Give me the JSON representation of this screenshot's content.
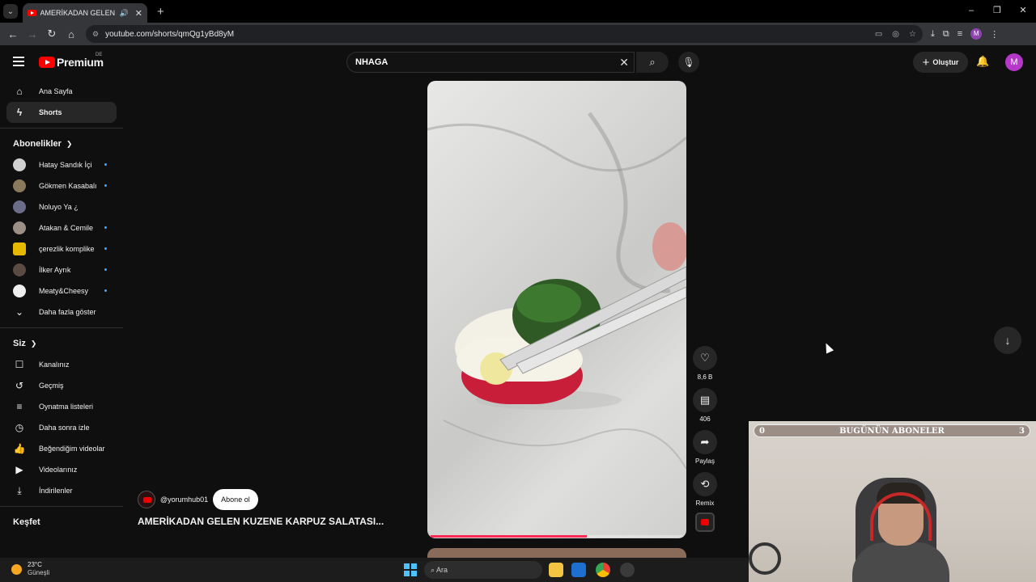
{
  "browser": {
    "tab_title": "AMERİKADAN GELEN KUZENE KARPUZ SALATASI",
    "tab_audio_icon": "speaker-icon",
    "url": "youtube.com/shorts/qmQg1yBd8yM",
    "window_controls": [
      "–",
      "❐",
      "✕"
    ]
  },
  "masthead": {
    "brand": "Premium",
    "country": "DE",
    "search_value": "NHAGA",
    "create_label": "Oluştur",
    "avatar_letter": "M"
  },
  "sidebar": {
    "main": [
      {
        "label": "Ana Sayfa",
        "icon": "home-icon"
      },
      {
        "label": "Shorts",
        "icon": "shorts-icon"
      }
    ],
    "subscriptions_title": "Abonelikler",
    "subscriptions": [
      {
        "label": "Hatay Sandık İçi",
        "color": "#d0d0d0",
        "new": true
      },
      {
        "label": "Gökmen Kasabalı",
        "color": "#8a7b5c",
        "new": true
      },
      {
        "label": "Noluyo Ya ¿",
        "color": "#6b6b8a",
        "new": false
      },
      {
        "label": "Atakan & Cemile",
        "color": "#9c8f86",
        "new": true
      },
      {
        "label": "çerezlik komplike",
        "color": "#e6b800",
        "new": true
      },
      {
        "label": "İlker Ayrık",
        "color": "#5a4a42",
        "new": true
      },
      {
        "label": "Meaty&Cheesy",
        "color": "#eeeeee",
        "new": true
      }
    ],
    "show_more": "Daha fazla göster",
    "you_title": "Siz",
    "you_items": [
      {
        "label": "Kanalınız",
        "icon": "channel-icon"
      },
      {
        "label": "Geçmiş",
        "icon": "history-icon"
      },
      {
        "label": "Oynatma listeleri",
        "icon": "playlists-icon"
      },
      {
        "label": "Daha sonra izle",
        "icon": "clock-icon"
      },
      {
        "label": "Beğendiğim videolar",
        "icon": "thumbs-up-icon"
      },
      {
        "label": "Videolarınız",
        "icon": "videos-icon"
      },
      {
        "label": "İndirilenler",
        "icon": "download-icon"
      }
    ],
    "explore_title": "Keşfet"
  },
  "short": {
    "channel": "@yorumhub01",
    "subscribe_label": "Abone ol",
    "title": "AMERİKADAN GELEN KUZENE KARPUZ SALATASI...",
    "progress": 0.62,
    "actions": [
      {
        "label": "8,6 B",
        "icon": "like-icon"
      },
      {
        "label": "406",
        "icon": "comment-icon"
      },
      {
        "label": "Paylaş",
        "icon": "share-icon"
      },
      {
        "label": "Remix",
        "icon": "remix-icon"
      }
    ]
  },
  "webcam": {
    "left_count": "0",
    "banner": "BUGÜNÜN ABONELER",
    "right_count": "3"
  },
  "taskbar": {
    "temperature": "23°C",
    "weather": "Güneşli",
    "search_placeholder": "Ara"
  }
}
